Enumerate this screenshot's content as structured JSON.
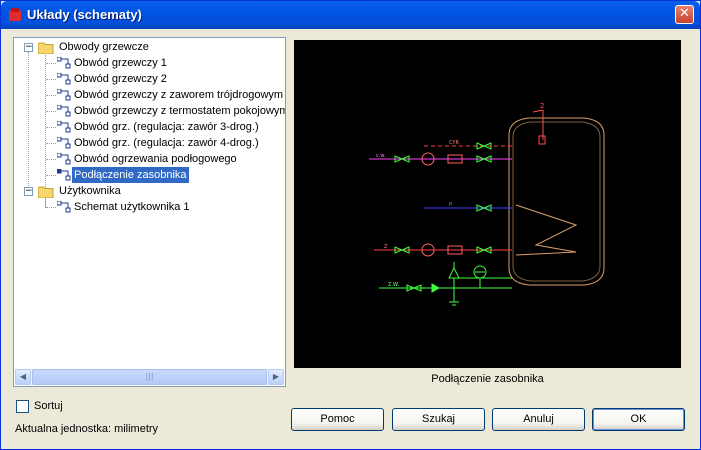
{
  "window": {
    "title": "Układy (schematy)"
  },
  "tree": {
    "groups": [
      {
        "label": "Obwody grzewcze",
        "expanded": true,
        "items": [
          "Obwód grzewczy 1",
          "Obwód grzewczy 2",
          "Obwód grzewczy z zaworem trójdrogowym",
          "Obwód grzewczy z termostatem pokojowym",
          "Obwód grz. (regulacja: zawór 3-drog.)",
          "Obwód grz. (regulacja: zawór 4-drog.)",
          "Obwód ogrzewania podłogowego",
          "Podłączenie zasobnika"
        ]
      },
      {
        "label": "Użytkownika",
        "expanded": true,
        "items": [
          "Schemat użytkownika 1"
        ]
      }
    ],
    "selected_item": "Podłączenie zasobnika"
  },
  "preview": {
    "caption": "Podłączenie zasobnika",
    "labels": {
      "cyrk": "CYR",
      "c": "c.w.",
      "p": "P",
      "z": "Z",
      "zw": "Z.W.",
      "top": "2"
    }
  },
  "options": {
    "sort_label": "Sortuj",
    "sort_checked": false
  },
  "status": {
    "units_text": "Aktualna jednostka: milimetry"
  },
  "buttons": {
    "help": "Pomoc",
    "search": "Szukaj",
    "cancel": "Anuluj",
    "ok": "OK"
  },
  "colors": {
    "title_bar": "#0054E3",
    "selection": "#316AC5",
    "preview_bg": "#000000",
    "tank": "#D9A066"
  }
}
